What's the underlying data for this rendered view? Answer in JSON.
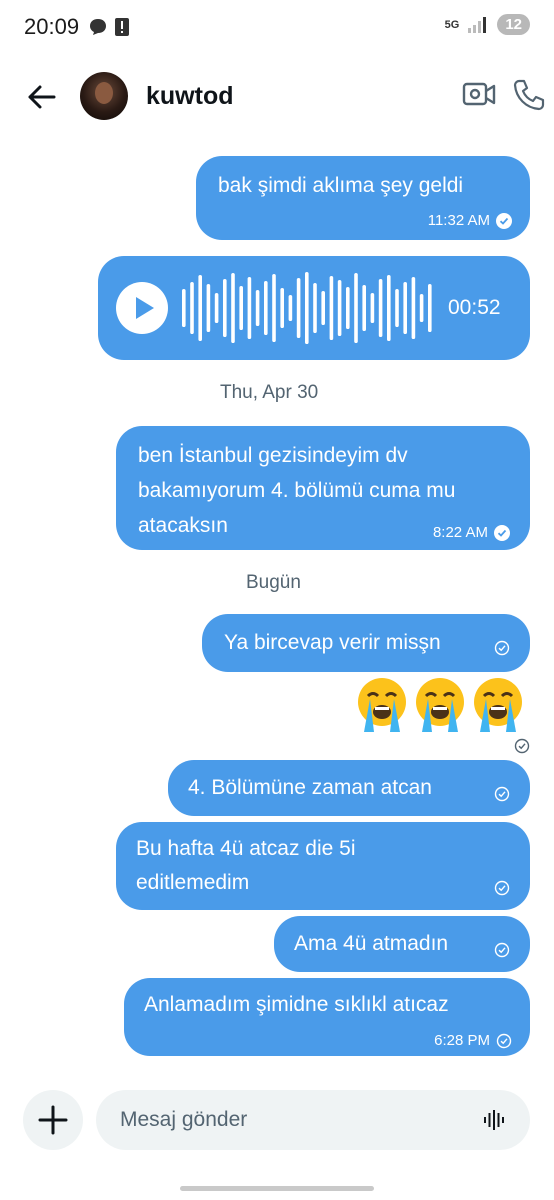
{
  "status_bar": {
    "time": "20:09",
    "network": "5G",
    "battery": "12"
  },
  "header": {
    "contact_name": "kuwtod"
  },
  "messages": [
    {
      "text": "bak şimdi aklıma şey geldi",
      "time": "11:32 AM"
    },
    {
      "type": "voice",
      "duration": "00:52"
    },
    {
      "text": "ben İstanbul gezisindeyim dv bakamıyorum 4. bölümü cuma mu atacaksın",
      "time": "8:22 AM"
    },
    {
      "text": "Ya bircevap verir misşn"
    },
    {
      "emoji": "😭😭😭"
    },
    {
      "text": "4. Bölümüne zaman atcan"
    },
    {
      "text": "Bu hafta 4ü atcaz die 5i editlemedim"
    },
    {
      "text": "Ama 4ü atmadın"
    },
    {
      "text": "Anlamadım şimidne sıklıkl atıcaz",
      "time": "6:28 PM"
    }
  ],
  "date_separators": [
    "Thu, Apr 30",
    "Bugün"
  ],
  "composer": {
    "placeholder": "Mesaj gönder"
  },
  "colors": {
    "bubble": "#4a9be9",
    "text_secondary": "#536471",
    "input_bg": "#eff3f4"
  }
}
